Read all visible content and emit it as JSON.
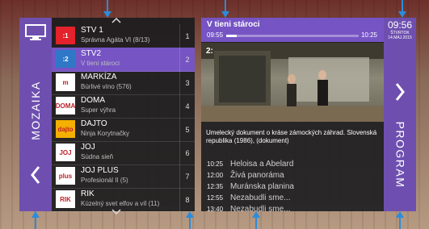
{
  "left_panel": {
    "label": "MOZAIKA"
  },
  "channels": [
    {
      "name": "STV 1",
      "show": "Správna Agáta VI (8/13)",
      "number": "1",
      "logo": ":1",
      "color": "#e3222b",
      "active": false
    },
    {
      "name": "STV2",
      "show": "V tieni stároci",
      "number": "2",
      "logo": ":2",
      "color": "#2f78c8",
      "active": true
    },
    {
      "name": "MARKÍZA",
      "show": "Búrlivé víno (576)",
      "number": "3",
      "logo": "m",
      "color": "#ffffff",
      "active": false
    },
    {
      "name": "DOMA",
      "show": "Super výhra",
      "number": "4",
      "logo": "DOMA",
      "color": "#ffffff",
      "active": false
    },
    {
      "name": "DAJTO",
      "show": "Ninja Korytnačky",
      "number": "5",
      "logo": "dajto",
      "color": "#f3b000",
      "active": false
    },
    {
      "name": "JOJ",
      "show": "Súdna sieň",
      "number": "6",
      "logo": "JOJ",
      "color": "#ffffff",
      "active": false
    },
    {
      "name": "JOJ PLUS",
      "show": "Profesionál II (5)",
      "number": "7",
      "logo": "plus",
      "color": "#ffffff",
      "active": false
    },
    {
      "name": "RIK",
      "show": "Kúzelný svet elfov a víl (11)",
      "number": "8",
      "logo": "RIK",
      "color": "#ffffff",
      "active": false
    }
  ],
  "now_playing": {
    "title": "V tieni stároci",
    "start": "09:55",
    "end": "10:25",
    "progress": 0.08,
    "channel_logo": "2:",
    "description": "Umelecký dokument o kráse zámockých záhrad. Slovenská republika (1986), (dokument)"
  },
  "epg": [
    {
      "time": "10:25",
      "title": "Heloisa a Abelard"
    },
    {
      "time": "12:00",
      "title": "Živá panoráma"
    },
    {
      "time": "12:35",
      "title": "Muránska planina"
    },
    {
      "time": "12:55",
      "title": "Nezabudli sme..."
    },
    {
      "time": "13:40",
      "title": "Nezabudli sme..."
    }
  ],
  "right_panel": {
    "clock": "09:56",
    "day": "ŠTVRTOK",
    "date": "14.MÁJ.2015",
    "label": "PROGRAM"
  },
  "colors": {
    "accent": "#7654c4",
    "panel": "#6e4fb0",
    "callout": "#2a8cdc"
  }
}
